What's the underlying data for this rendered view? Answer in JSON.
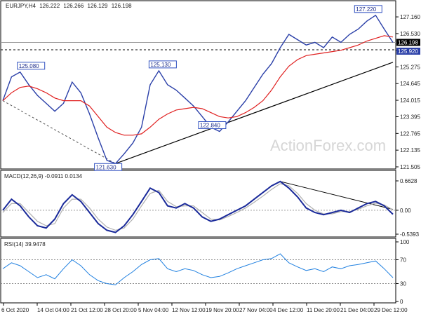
{
  "header": {
    "symbol": "EURJPY,H4",
    "open": "126.222",
    "high": "126.266",
    "low": "126.129",
    "close": "126.198"
  },
  "watermark": "ActionForex.com",
  "macd_label": "MACD(12,26,9) -0.0911 0.0134",
  "rsi_label": "RSI(14) 39.9478",
  "chart_data": [
    {
      "type": "line",
      "title": "EURJPY,H4 126.222 126.266 126.129 126.198",
      "x_ticks": [
        "6 Oct 2020",
        "14 Oct 04:00",
        "21 Oct 12:00",
        "28 Oct 20:00",
        "5 Nov 04:00",
        "12 Nov 12:00",
        "19 Nov 20:00",
        "27 Nov 04:00",
        "4 Dec 12:00",
        "11 Dec 20:00",
        "21 Dec 04:00",
        "29 Dec 12:00"
      ],
      "y_ticks": [
        "127.160",
        "126.530",
        "125.900",
        "125.275",
        "124.645",
        "124.015",
        "123.395",
        "122.765",
        "122.135",
        "121.505"
      ],
      "ylim": [
        121.505,
        127.4
      ],
      "series": [
        {
          "values": [
            124.0,
            124.9,
            125.08,
            124.6,
            124.2,
            123.9,
            123.6,
            123.9,
            124.7,
            124.3,
            123.5,
            122.6,
            121.75,
            121.63,
            122.0,
            122.4,
            123.0,
            124.6,
            125.13,
            124.6,
            124.4,
            124.1,
            123.8,
            123.4,
            123.0,
            122.84,
            123.2,
            123.6,
            124.0,
            124.5,
            125.0,
            125.4,
            126.0,
            126.5,
            126.3,
            126.1,
            126.2,
            126.0,
            126.4,
            126.2,
            126.5,
            126.7,
            127.0,
            127.22,
            126.7,
            126.198
          ]
        },
        {
          "values": [
            124.0,
            124.3,
            124.5,
            124.55,
            124.45,
            124.3,
            124.1,
            124.0,
            124.0,
            124.0,
            123.8,
            123.4,
            123.0,
            122.8,
            122.7,
            122.7,
            122.75,
            123.0,
            123.3,
            123.5,
            123.65,
            123.7,
            123.75,
            123.7,
            123.55,
            123.4,
            123.35,
            123.4,
            123.55,
            123.75,
            124.0,
            124.4,
            124.9,
            125.3,
            125.55,
            125.7,
            125.75,
            125.8,
            125.85,
            125.9,
            126.0,
            126.1,
            126.25,
            126.35,
            126.45,
            126.4
          ]
        }
      ],
      "annotations": [
        "125.080",
        "125.130",
        "122.840",
        "121.630",
        "127.220"
      ],
      "price_labels": [
        "126.198",
        "125.920"
      ],
      "grid": false
    },
    {
      "type": "line",
      "title": "MACD(12,26,9) -0.0911 0.0134",
      "y_ticks": [
        "0.6628",
        "0.00",
        "-0.5393"
      ],
      "ylim": [
        -0.5393,
        0.6628
      ],
      "series": [
        {
          "values": [
            0.0,
            0.25,
            0.1,
            -0.15,
            -0.35,
            -0.4,
            -0.2,
            0.15,
            0.35,
            0.2,
            -0.05,
            -0.3,
            -0.45,
            -0.5,
            -0.35,
            -0.1,
            0.2,
            0.5,
            0.4,
            0.1,
            0.05,
            0.15,
            0.05,
            -0.15,
            -0.25,
            -0.2,
            -0.1,
            0.0,
            0.1,
            0.25,
            0.4,
            0.55,
            0.65,
            0.5,
            0.3,
            0.05,
            -0.05,
            -0.1,
            -0.05,
            0.0,
            -0.05,
            0.05,
            0.15,
            0.2,
            0.1,
            -0.09
          ]
        },
        {
          "values": [
            -0.05,
            0.15,
            0.15,
            -0.05,
            -0.25,
            -0.35,
            -0.3,
            0.05,
            0.25,
            0.25,
            0.05,
            -0.2,
            -0.38,
            -0.45,
            -0.4,
            -0.2,
            0.1,
            0.38,
            0.45,
            0.2,
            0.08,
            0.1,
            0.1,
            -0.05,
            -0.2,
            -0.22,
            -0.14,
            -0.05,
            0.05,
            0.18,
            0.32,
            0.47,
            0.6,
            0.55,
            0.38,
            0.15,
            0.0,
            -0.08,
            -0.08,
            -0.03,
            -0.03,
            0.02,
            0.1,
            0.16,
            0.12,
            0.01
          ]
        }
      ]
    },
    {
      "type": "line",
      "title": "RSI(14) 39.9478",
      "y_ticks": [
        "100",
        "70",
        "30",
        "0"
      ],
      "ylim": [
        0,
        100
      ],
      "series": [
        {
          "values": [
            55,
            65,
            60,
            50,
            40,
            45,
            38,
            55,
            70,
            60,
            45,
            35,
            30,
            28,
            40,
            50,
            62,
            70,
            72,
            55,
            50,
            55,
            52,
            45,
            40,
            42,
            48,
            55,
            60,
            65,
            70,
            72,
            80,
            65,
            58,
            52,
            55,
            50,
            58,
            55,
            60,
            62,
            65,
            68,
            55,
            40
          ]
        }
      ]
    }
  ]
}
